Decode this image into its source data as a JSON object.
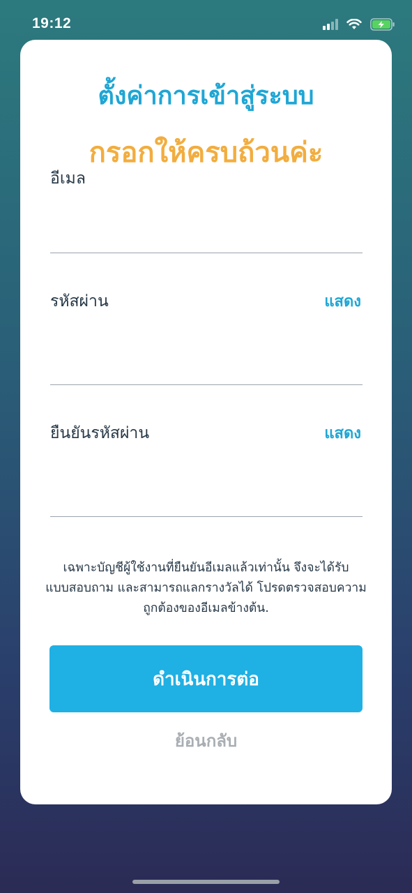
{
  "status_bar": {
    "time": "19:12",
    "icons": [
      "cellular-signal-icon",
      "wifi-icon",
      "battery-charging-icon"
    ],
    "battery_color": "#59d35f"
  },
  "form": {
    "title": "ตั้งค่าการเข้าสู่ระบบ",
    "subtitle": "กรอกให้ครบถ้วนค่ะ",
    "email_label": "อีเมล",
    "email_value": "",
    "password_label": "รหัสผ่าน",
    "password_value": "",
    "password_show_label": "แสดง",
    "confirm_label": "ยืนยันรหัสผ่าน",
    "confirm_value": "",
    "confirm_show_label": "แสดง",
    "note_lines": [
      "เฉพาะบัญชีผู้ใช้งานที่ยืนยันอีเมลแล้วเท่านั้น จึงจะได้รับ",
      "แบบสอบถาม และสามารถแลกรางวัลได้ โปรดตรวจสอบความ",
      "ถูกต้องของอีเมลข้างต้น."
    ],
    "continue_label": "ดำเนินการต่อ",
    "back_label": "ย้อนกลับ"
  },
  "colors": {
    "accent": "#1fb0e4",
    "title": "#1fa6d4",
    "subtitle": "#f2ad3f",
    "muted": "#a9aeb3"
  }
}
